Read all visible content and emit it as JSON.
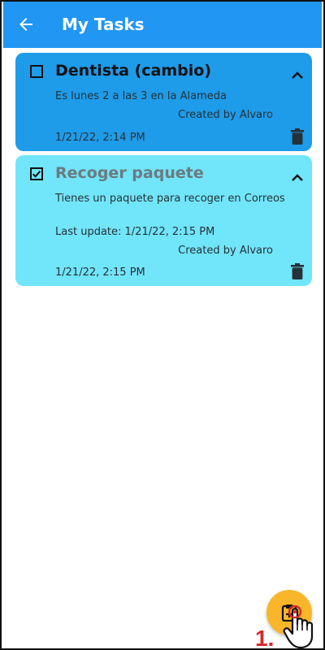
{
  "app_bar": {
    "title": "My Tasks",
    "back_icon": "arrow-left-icon",
    "color": "#2196f3"
  },
  "tasks": [
    {
      "title": "Dentista (cambio)",
      "checked": false,
      "description": "Es lunes 2 a las 3 en la Alameda",
      "last_update": "",
      "created_by": "Created by Alvaro",
      "timestamp": "1/21/22, 2:14 PM",
      "card_color": "#1e9be9"
    },
    {
      "title": "Recoger paquete",
      "checked": true,
      "description": "Tienes un paquete para recoger en Correos",
      "last_update": "Last update: 1/21/22, 2:15 PM",
      "created_by": "Created by Alvaro",
      "timestamp": "1/21/22, 2:15 PM",
      "card_color": "#71e5f9"
    }
  ],
  "fab": {
    "icon": "clipboard-add-icon",
    "color": "#f9b62a"
  },
  "annotation": {
    "step_label": "1.",
    "cursor_icon": "hand-pointer-icon"
  }
}
